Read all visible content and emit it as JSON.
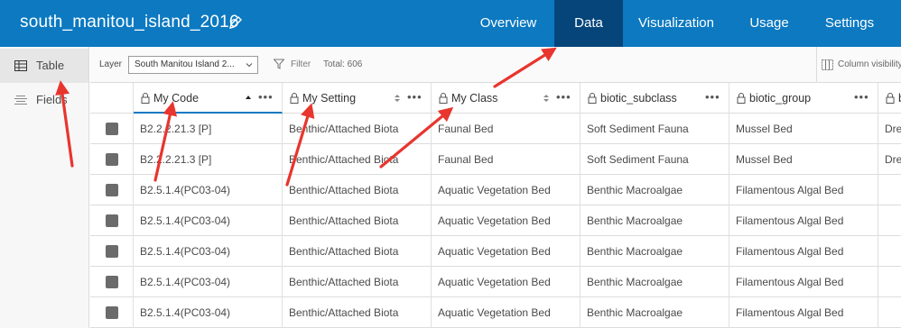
{
  "header": {
    "title": "south_manitou_island_2016",
    "edit_icon": "pencil-icon",
    "tabs": [
      {
        "label": "Overview",
        "active": false
      },
      {
        "label": "Data",
        "active": true
      },
      {
        "label": "Visualization",
        "active": false
      },
      {
        "label": "Usage",
        "active": false
      },
      {
        "label": "Settings",
        "active": false
      }
    ]
  },
  "sidebar": {
    "items": [
      {
        "label": "Table",
        "icon": "table-icon",
        "active": true
      },
      {
        "label": "Fields",
        "icon": "fields-list-icon",
        "active": false
      }
    ]
  },
  "toolbar": {
    "layer_label": "Layer",
    "layer_value": "South Manitou Island 2...",
    "filter_label": "Filter",
    "total_label": "Total: 606",
    "column_visibility_label": "Column visibility"
  },
  "table": {
    "columns": [
      {
        "label": "My Code",
        "sorted": "ascending"
      },
      {
        "label": "My Setting",
        "sorted": "none"
      },
      {
        "label": "My Class",
        "sorted": "none"
      },
      {
        "label": "biotic_subclass",
        "sorted": "none"
      },
      {
        "label": "biotic_group",
        "sorted": "none"
      },
      {
        "label": "biotic_community",
        "sorted": "none"
      }
    ],
    "rows": [
      [
        "B2.2.2.21.3 [P]",
        "Benthic/Attached Biota",
        "Faunal Bed",
        "Soft Sediment Fauna",
        "Mussel Bed",
        "Dreissenid Mussel Bed"
      ],
      [
        "B2.2.2.21.3 [P]",
        "Benthic/Attached Biota",
        "Faunal Bed",
        "Soft Sediment Fauna",
        "Mussel Bed",
        "Dreissenid Mussel Bed"
      ],
      [
        "B2.5.1.4(PC03-04)",
        "Benthic/Attached Biota",
        "Aquatic Vegetation Bed",
        "Benthic Macroalgae",
        "Filamentous Algal Bed",
        ""
      ],
      [
        "B2.5.1.4(PC03-04)",
        "Benthic/Attached Biota",
        "Aquatic Vegetation Bed",
        "Benthic Macroalgae",
        "Filamentous Algal Bed",
        ""
      ],
      [
        "B2.5.1.4(PC03-04)",
        "Benthic/Attached Biota",
        "Aquatic Vegetation Bed",
        "Benthic Macroalgae",
        "Filamentous Algal Bed",
        ""
      ],
      [
        "B2.5.1.4(PC03-04)",
        "Benthic/Attached Biota",
        "Aquatic Vegetation Bed",
        "Benthic Macroalgae",
        "Filamentous Algal Bed",
        ""
      ],
      [
        "B2.5.1.4(PC03-04)",
        "Benthic/Attached Biota",
        "Aquatic Vegetation Bed",
        "Benthic Macroalgae",
        "Filamentous Algal Bed",
        ""
      ]
    ]
  },
  "colors": {
    "header_bg": "#0c79c1",
    "active_tab_bg": "#06457a",
    "annotation_arrow": "#e8352e"
  }
}
